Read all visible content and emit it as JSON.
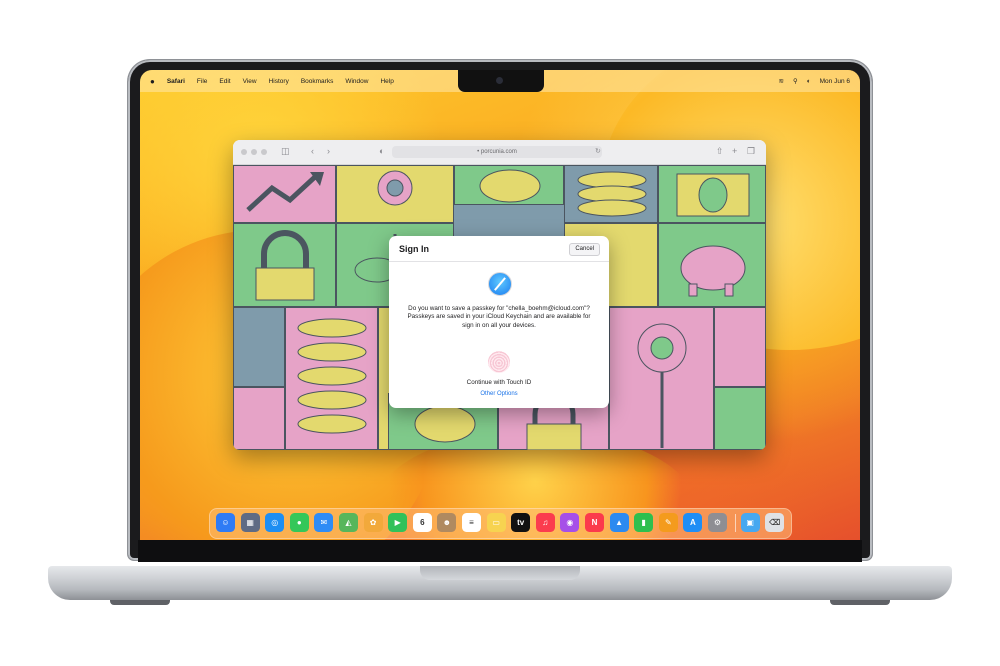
{
  "menubar": {
    "apple": "",
    "app": "Safari",
    "menus": [
      "File",
      "Edit",
      "View",
      "History",
      "Bookmarks",
      "Window",
      "Help"
    ],
    "clock": "Mon Jun 6",
    "status_icons": [
      "wifi-icon",
      "search-icon",
      "control-center-icon"
    ]
  },
  "safari": {
    "url": "porcunia.com",
    "toolbar_icons": [
      "sidebar-icon",
      "back-icon",
      "forward-icon",
      "shield-icon",
      "reload-icon",
      "share-icon",
      "new-tab-icon",
      "tab-overview-icon"
    ]
  },
  "sheet": {
    "title": "Sign In",
    "cancel": "Cancel",
    "message": "Do you want to save a passkey for \"chella_boehm@icloud.com\"? Passkeys are saved in your iCloud Keychain and are available for sign in on all your devices.",
    "touch_label": "Continue with Touch ID",
    "other_options": "Other Options"
  },
  "dock": {
    "apps": [
      "Finder",
      "Launchpad",
      "Safari",
      "Messages",
      "Mail",
      "Maps",
      "Photos",
      "FaceTime",
      "Calendar",
      "Contacts",
      "Reminders",
      "Notes",
      "TV",
      "Music",
      "Podcasts",
      "News",
      "Keynote",
      "Numbers",
      "Pages",
      "App Store",
      "System Preferences",
      "Downloads",
      "Trash"
    ],
    "calendar_day": "6",
    "colors": {
      "Finder": "#2f7bf5",
      "Launchpad": "#5f6b84",
      "Safari": "#1e8ef2",
      "Messages": "#34c759",
      "Mail": "#2f8cf5",
      "Maps": "#57b65b",
      "Photos": "#f2a93b",
      "FaceTime": "#31c15a",
      "Calendar": "#ffffff",
      "Contacts": "#b08a60",
      "Reminders": "#ffffff",
      "Notes": "#f7d350",
      "TV": "#111111",
      "Music": "#fb3c4e",
      "Podcasts": "#a64fe8",
      "News": "#fb3a4c",
      "Keynote": "#2c8af0",
      "Numbers": "#2fbf4e",
      "Pages": "#f49b1d",
      "App Store": "#1f8ef5",
      "System Preferences": "#8e8e93",
      "Downloads": "#46a8f0",
      "Trash": "#dfe2e6"
    }
  }
}
